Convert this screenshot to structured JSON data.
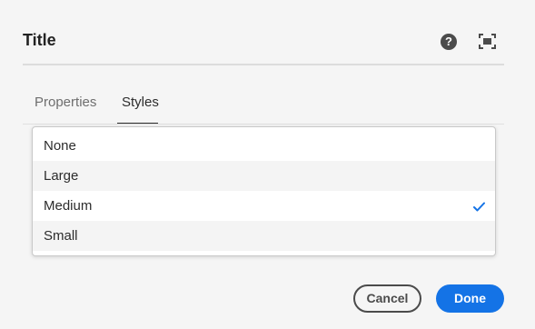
{
  "dialog": {
    "title": "Title",
    "help_icon": "question-circle-icon",
    "help_glyph": "?",
    "fullscreen_icon": "fullscreen-icon"
  },
  "tabs": [
    {
      "label": "Properties",
      "active": false
    },
    {
      "label": "Styles",
      "active": true
    }
  ],
  "dropdown": {
    "options": [
      {
        "label": "None",
        "selected": false
      },
      {
        "label": "Large",
        "selected": false
      },
      {
        "label": "Medium",
        "selected": true
      },
      {
        "label": "Small",
        "selected": false
      }
    ],
    "check_icon": "checkmark-icon"
  },
  "footer": {
    "cancel_label": "Cancel",
    "done_label": "Done"
  },
  "colors": {
    "accent": "#1473e6",
    "background": "#f5f5f5"
  }
}
